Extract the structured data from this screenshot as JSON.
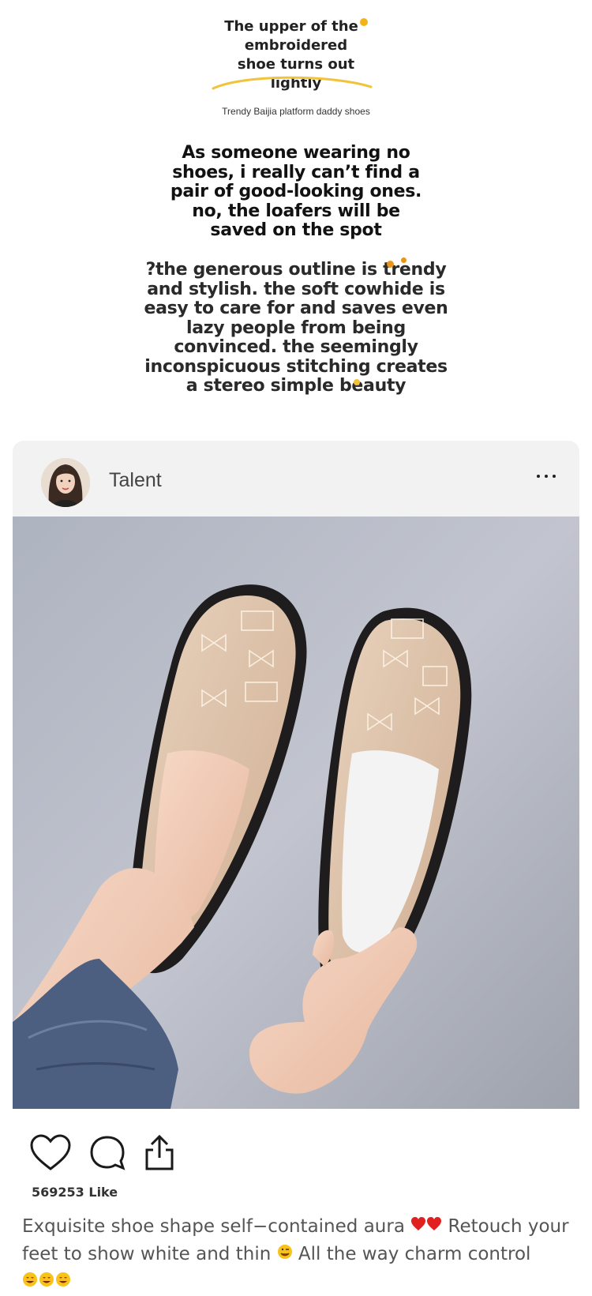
{
  "headline": {
    "lines": [
      "The upper of the",
      "embroidered",
      "shoe turns out",
      "lightly"
    ]
  },
  "subtag": "Trendy Baijia platform daddy shoes",
  "para1": {
    "lines": [
      "As someone wearing no",
      "shoes, i really can’t find a",
      "pair of good-looking ones.",
      "no, the loafers will be",
      "saved on the spot"
    ]
  },
  "para2": {
    "lines": [
      "?the generous outline is trendy",
      "and stylish. the soft cowhide is",
      "easy to care for and saves even",
      "lazy people from being",
      "convinced. the seemingly",
      "inconspicuous stitching creates",
      "a stereo simple beauty"
    ]
  },
  "post": {
    "username": "Talent",
    "likes": "569253 Like",
    "caption_part1": "Exquisite shoe shape self−contained aura",
    "caption_part2": "Retouch your feet to show white and thin",
    "caption_part3": "All the way charm control"
  },
  "icons": {
    "heart": "heart-icon",
    "comment": "comment-icon",
    "share": "share-icon",
    "more": "more-icon"
  },
  "colors": {
    "accent_gold": "#f2b319",
    "header_bg": "#f2f2f2",
    "photo_bg": "#b4b7c2",
    "heart_red": "#e0211f"
  }
}
